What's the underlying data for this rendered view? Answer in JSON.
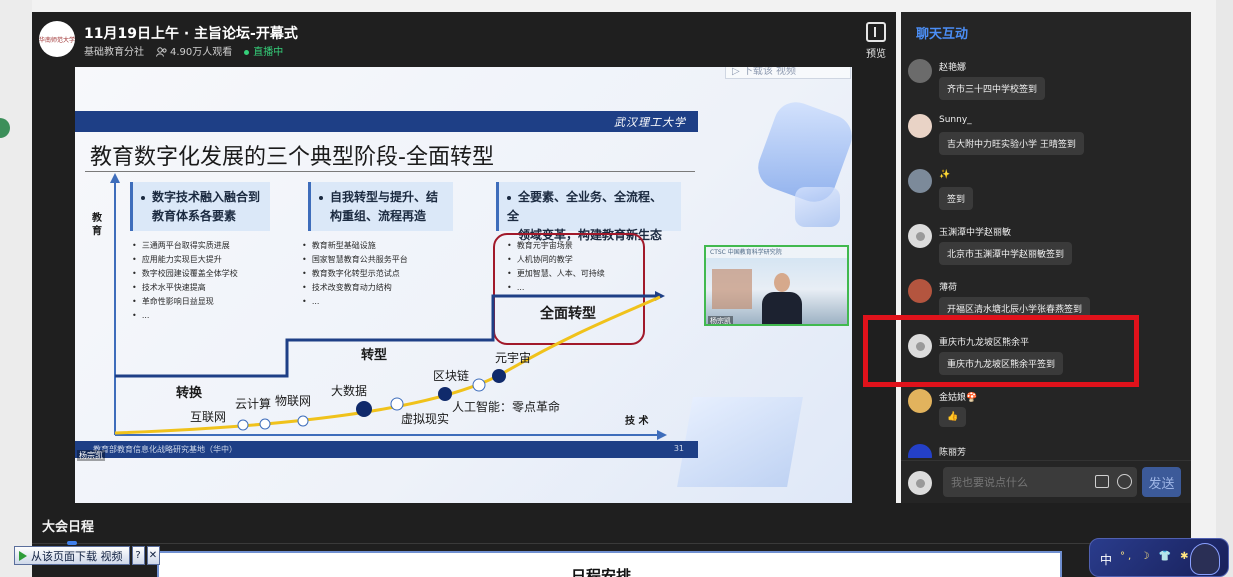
{
  "stream": {
    "title": "11月19日上午 · 主旨论坛-开幕式",
    "channel": "基础教育分社",
    "viewers": "4.90万人观看",
    "status": "直播中",
    "preview_label": "预览",
    "logo_text": "华南师范大学"
  },
  "slide": {
    "download_hint": "▷ 下载该 视频",
    "brand": "武汉理工大学",
    "title": "教育数字化发展的三个典型阶段-全面转型",
    "stages": [
      {
        "heading": [
          "数字技术融入融合到",
          "教育体系各要素"
        ],
        "bullets": [
          "三通两平台取得实质进展",
          "应用能力实现巨大提升",
          "数字校园建设覆盖全体学校",
          "技术水平快速提高",
          "革命性影响日益显现",
          "..."
        ]
      },
      {
        "heading": [
          "自我转型与提升、结",
          "构重组、流程再造"
        ],
        "bullets": [
          "教育新型基础设施",
          "国家智慧教育公共服务平台",
          "教育数字化转型示范试点",
          "技术改变教育动力结构",
          "..."
        ]
      },
      {
        "heading": [
          "全要素、全业务、全流程、全",
          "领域变革，构建教育新生态"
        ],
        "bullets": [
          "教育元宇宙场景",
          "人机协同的教学",
          "更加智慧、人本、可持续",
          "..."
        ]
      }
    ],
    "transformation_label": "全面转型",
    "y_axis_label": "教育",
    "step_labels": [
      "转换",
      "转型"
    ],
    "tech_labels": [
      "互联网",
      "云计算",
      "物联网",
      "大数据",
      "虚拟现实",
      "区块链",
      "人工智能：零点革命",
      "元宇宙"
    ],
    "x_axis_label": "技 术",
    "footer": "教育部教育信息化战略研究基地（华中）",
    "page_no": "31",
    "speaker_tag": "杨宗凯"
  },
  "inset": {
    "banner": "CTSC 中国教育科学研究院",
    "name": "杨宗凯"
  },
  "chat": {
    "tab": "聊天互动",
    "messages": [
      {
        "user": "赵艳娜",
        "text": "齐市三十四中学校签到"
      },
      {
        "user": "Sunny_",
        "text": "吉大附中力旺实验小学 王晴签到"
      },
      {
        "user": "✨",
        "text": "签到"
      },
      {
        "user": "玉渊潭中学赵丽敏",
        "text": "北京市玉渊潭中学赵丽敏签到"
      },
      {
        "user": "薄荷",
        "text": "开福区清水塘北辰小学张春燕签到"
      },
      {
        "user": "重庆市九龙坡区熊余平",
        "text": "重庆市九龙坡区熊余平签到"
      },
      {
        "user": "金姑娘🍄",
        "text": "👍"
      },
      {
        "user": "陈丽芳",
        "text": ""
      }
    ],
    "input_placeholder": "我也要说点什么",
    "send_label": "发送"
  },
  "agenda": {
    "title": "大会日程",
    "heading": "日程安排"
  },
  "download_toolbar": {
    "label": "从该页面下载 视频",
    "help": "?",
    "close": "✕"
  },
  "ime": {
    "label": "中",
    "icons": "°, ☽ 👕 ✱"
  },
  "colors": {
    "accent": "#4b8ef5",
    "live": "#35d07a",
    "highlight": "#e0121b",
    "slide_bar": "#1e3f86"
  }
}
